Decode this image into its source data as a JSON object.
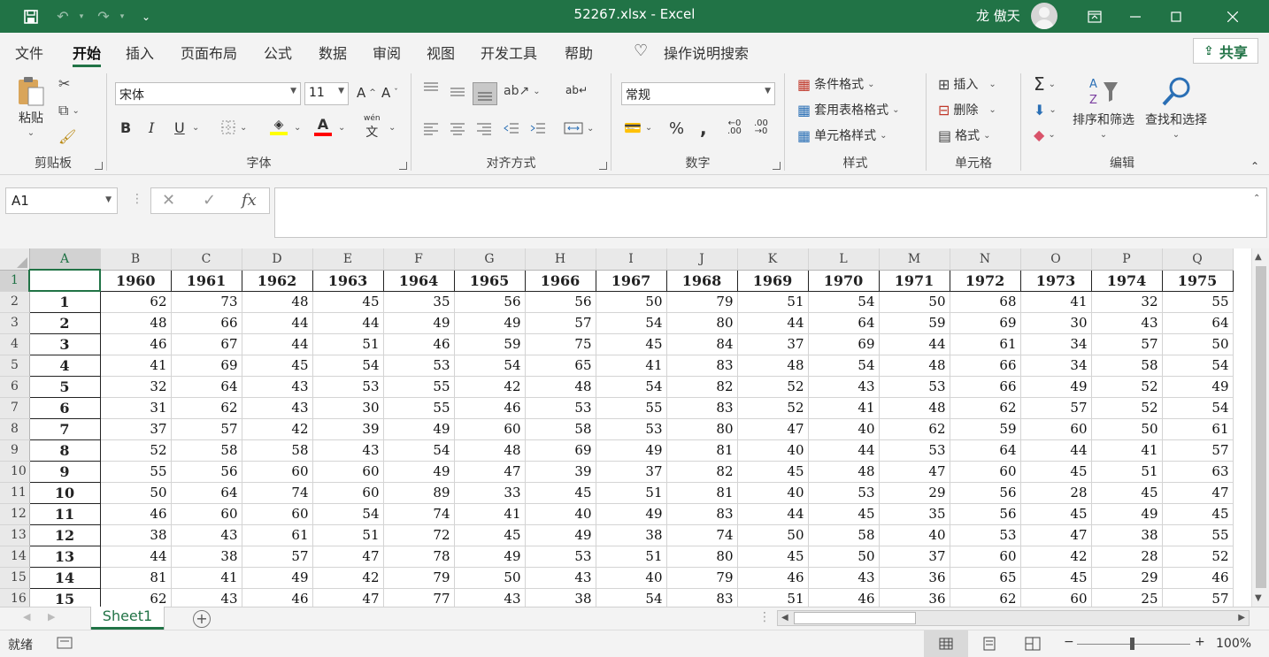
{
  "titlebar": {
    "title": "52267.xlsx  -  Excel",
    "user": "龙 傲天",
    "quick_access": {
      "save_icon": "save-icon",
      "undo_icon": "undo-icon",
      "redo_icon": "redo-icon",
      "customize_icon": "customize-qat-icon"
    },
    "window_buttons": [
      "ribbon-display-icon",
      "minimize-icon",
      "maximize-icon",
      "close-icon"
    ]
  },
  "menu": {
    "tabs": [
      "文件",
      "开始",
      "插入",
      "页面布局",
      "公式",
      "数据",
      "审阅",
      "视图",
      "开发工具",
      "帮助"
    ],
    "active_tab": "开始",
    "tell_me": "操作说明搜索",
    "share": "共享"
  },
  "ribbon": {
    "clipboard": {
      "label": "剪贴板",
      "paste": "粘贴"
    },
    "font": {
      "label": "字体",
      "font_name": "宋体",
      "font_size": "11",
      "bold": "B",
      "italic": "I",
      "underline": "U",
      "wen": "wén",
      "font_color": "#ff0000",
      "fill_color": "#ffff00"
    },
    "alignment": {
      "label": "对齐方式"
    },
    "number": {
      "label": "数字",
      "format": "常规",
      "percent": "%",
      "comma": ","
    },
    "styles": {
      "label": "样式",
      "conditional": "条件格式",
      "table": "套用表格格式",
      "cell": "单元格样式"
    },
    "cells": {
      "label": "单元格",
      "insert": "插入",
      "delete": "删除",
      "format": "格式"
    },
    "editing": {
      "label": "编辑",
      "sort": "排序和筛选",
      "find": "查找和选择"
    }
  },
  "formula_bar": {
    "name_box": "A1",
    "content": ""
  },
  "sheet": {
    "columns": [
      "A",
      "B",
      "C",
      "D",
      "E",
      "F",
      "G",
      "H",
      "I",
      "J",
      "K",
      "L",
      "M",
      "N",
      "O",
      "P",
      "Q"
    ],
    "row_numbers": [
      1,
      2,
      3,
      4,
      5,
      6,
      7,
      8,
      9,
      10,
      11,
      12,
      13,
      14,
      15,
      16
    ],
    "header_years": [
      1960,
      1961,
      1962,
      1963,
      1964,
      1965,
      1966,
      1967,
      1968,
      1969,
      1970,
      1971,
      1972,
      1973,
      1974,
      1975
    ],
    "rows": [
      {
        "idx": 1,
        "values": [
          62,
          73,
          48,
          45,
          35,
          56,
          56,
          50,
          79,
          51,
          54,
          50,
          68,
          41,
          32,
          55
        ]
      },
      {
        "idx": 2,
        "values": [
          48,
          66,
          44,
          44,
          49,
          49,
          57,
          54,
          80,
          44,
          64,
          59,
          69,
          30,
          43,
          64
        ]
      },
      {
        "idx": 3,
        "values": [
          46,
          67,
          44,
          51,
          46,
          59,
          75,
          45,
          84,
          37,
          69,
          44,
          61,
          34,
          57,
          50
        ]
      },
      {
        "idx": 4,
        "values": [
          41,
          69,
          45,
          54,
          53,
          54,
          65,
          41,
          83,
          48,
          54,
          48,
          66,
          34,
          58,
          54
        ]
      },
      {
        "idx": 5,
        "values": [
          32,
          64,
          43,
          53,
          55,
          42,
          48,
          54,
          82,
          52,
          43,
          53,
          66,
          49,
          52,
          49
        ]
      },
      {
        "idx": 6,
        "values": [
          31,
          62,
          43,
          30,
          55,
          46,
          53,
          55,
          83,
          52,
          41,
          48,
          62,
          57,
          52,
          54
        ]
      },
      {
        "idx": 7,
        "values": [
          37,
          57,
          42,
          39,
          49,
          60,
          58,
          53,
          80,
          47,
          40,
          62,
          59,
          60,
          50,
          61
        ]
      },
      {
        "idx": 8,
        "values": [
          52,
          58,
          58,
          43,
          54,
          48,
          69,
          49,
          81,
          40,
          44,
          53,
          64,
          44,
          41,
          57
        ]
      },
      {
        "idx": 9,
        "values": [
          55,
          56,
          60,
          60,
          49,
          47,
          39,
          37,
          82,
          45,
          48,
          47,
          60,
          45,
          51,
          63
        ]
      },
      {
        "idx": 10,
        "values": [
          50,
          64,
          74,
          60,
          89,
          33,
          45,
          51,
          81,
          40,
          53,
          29,
          56,
          28,
          45,
          47
        ]
      },
      {
        "idx": 11,
        "values": [
          46,
          60,
          60,
          54,
          74,
          41,
          40,
          49,
          83,
          44,
          45,
          35,
          56,
          45,
          49,
          45
        ]
      },
      {
        "idx": 12,
        "values": [
          38,
          43,
          61,
          51,
          72,
          45,
          49,
          38,
          74,
          50,
          58,
          40,
          53,
          47,
          38,
          55
        ]
      },
      {
        "idx": 13,
        "values": [
          44,
          38,
          57,
          47,
          78,
          49,
          53,
          51,
          80,
          45,
          50,
          37,
          60,
          42,
          28,
          52
        ]
      },
      {
        "idx": 14,
        "values": [
          81,
          41,
          49,
          42,
          79,
          50,
          43,
          40,
          79,
          46,
          43,
          36,
          65,
          45,
          29,
          46
        ]
      },
      {
        "idx": 15,
        "values": [
          62,
          43,
          46,
          47,
          77,
          43,
          38,
          54,
          83,
          51,
          46,
          36,
          62,
          60,
          25,
          57
        ]
      }
    ]
  },
  "sheet_tabs": {
    "tabs": [
      "Sheet1"
    ],
    "active": "Sheet1"
  },
  "status": {
    "ready": "就绪",
    "zoom": "100%"
  }
}
